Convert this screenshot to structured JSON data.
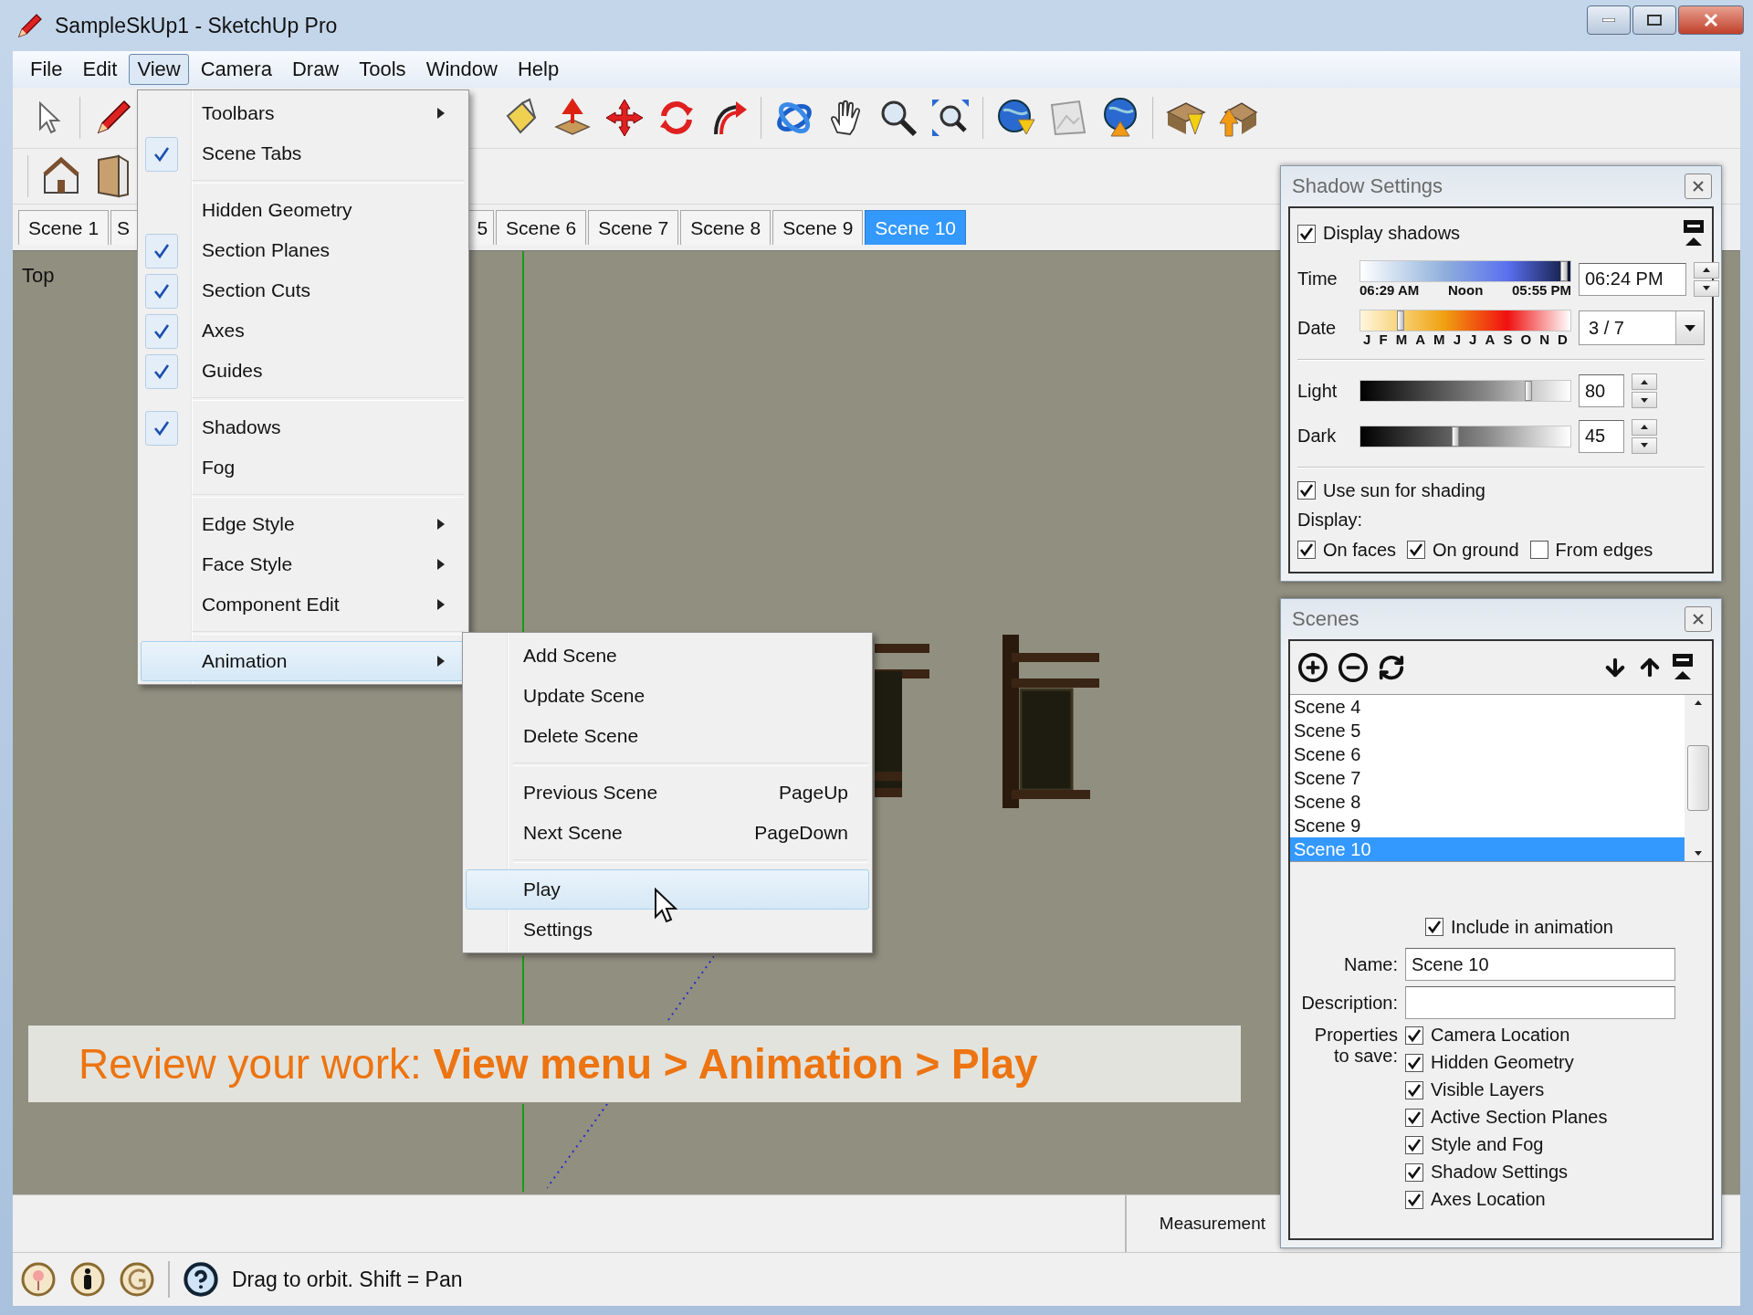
{
  "window": {
    "title": "SampleSkUp1 - SketchUp Pro"
  },
  "menu_bar": [
    {
      "label": "File",
      "selected": false
    },
    {
      "label": "Edit",
      "selected": false
    },
    {
      "label": "View",
      "selected": true
    },
    {
      "label": "Camera",
      "selected": false
    },
    {
      "label": "Draw",
      "selected": false
    },
    {
      "label": "Tools",
      "selected": false
    },
    {
      "label": "Window",
      "selected": false
    },
    {
      "label": "Help",
      "selected": false
    }
  ],
  "view_menu": {
    "groups": [
      {
        "items": [
          {
            "label": "Toolbars",
            "kind": "submenu",
            "checked": false,
            "highlighted": false
          },
          {
            "label": "Scene Tabs",
            "kind": "item",
            "checked": true,
            "highlighted": false
          }
        ]
      },
      {
        "items": [
          {
            "label": "Hidden Geometry",
            "kind": "item",
            "checked": false,
            "highlighted": false
          },
          {
            "label": "Section Planes",
            "kind": "item",
            "checked": true,
            "highlighted": false
          },
          {
            "label": "Section Cuts",
            "kind": "item",
            "checked": true,
            "highlighted": false
          },
          {
            "label": "Axes",
            "kind": "item",
            "checked": true,
            "highlighted": false
          },
          {
            "label": "Guides",
            "kind": "item",
            "checked": true,
            "highlighted": false
          }
        ]
      },
      {
        "items": [
          {
            "label": "Shadows",
            "kind": "item",
            "checked": true,
            "highlighted": false
          },
          {
            "label": "Fog",
            "kind": "item",
            "checked": false,
            "highlighted": false
          }
        ]
      },
      {
        "items": [
          {
            "label": "Edge Style",
            "kind": "submenu",
            "checked": false,
            "highlighted": false
          },
          {
            "label": "Face Style",
            "kind": "submenu",
            "checked": false,
            "highlighted": false
          },
          {
            "label": "Component Edit",
            "kind": "submenu",
            "checked": false,
            "highlighted": false
          }
        ]
      },
      {
        "items": [
          {
            "label": "Animation",
            "kind": "submenu",
            "checked": false,
            "highlighted": true
          }
        ]
      }
    ]
  },
  "animation_submenu": {
    "groups": [
      {
        "items": [
          {
            "label": "Add Scene",
            "highlighted": false
          },
          {
            "label": "Update Scene",
            "highlighted": false
          },
          {
            "label": "Delete Scene",
            "highlighted": false
          }
        ]
      },
      {
        "items": [
          {
            "label": "Previous Scene",
            "shortcut": "PageUp",
            "highlighted": false
          },
          {
            "label": "Next Scene",
            "shortcut": "PageDown",
            "highlighted": false
          }
        ]
      },
      {
        "items": [
          {
            "label": "Play",
            "highlighted": true
          },
          {
            "label": "Settings",
            "highlighted": false
          }
        ]
      }
    ]
  },
  "scene_tabs": [
    {
      "label": "Scene 1",
      "selected": false
    },
    {
      "label": "S",
      "selected": false
    },
    {
      "label": "5",
      "selected": false
    },
    {
      "label": "Scene 6",
      "selected": false
    },
    {
      "label": "Scene 7",
      "selected": false
    },
    {
      "label": "Scene 8",
      "selected": false
    },
    {
      "label": "Scene 9",
      "selected": false
    },
    {
      "label": "Scene 10",
      "selected": true
    }
  ],
  "viewport": {
    "view_label": "Top"
  },
  "caption": "Review your work: **View menu > Animation > Play**",
  "status_bar": {
    "measurement_label": "Measurement",
    "hint": "Drag to orbit.  Shift = Pan"
  },
  "shadow_settings": {
    "title": "Shadow Settings",
    "display_shadows": {
      "label": "Display shadows",
      "checked": true
    },
    "time": {
      "label": "Time",
      "level": 0.97,
      "ticks": [
        "06:29 AM",
        "Noon",
        "05:55 PM"
      ],
      "value": "06:24 PM"
    },
    "date": {
      "label": "Date",
      "level": 0.19,
      "months": [
        "J",
        "F",
        "M",
        "A",
        "M",
        "J",
        "J",
        "A",
        "S",
        "O",
        "N",
        "D"
      ],
      "value": "3 / 7"
    },
    "light": {
      "label": "Light",
      "level": 0.8,
      "value": "80"
    },
    "dark": {
      "label": "Dark",
      "level": 0.45,
      "value": "45"
    },
    "use_sun": {
      "label": "Use sun for shading",
      "checked": true
    },
    "display_label": "Display:",
    "display_options": [
      {
        "label": "On faces",
        "checked": true
      },
      {
        "label": "On ground",
        "checked": true
      },
      {
        "label": "From edges",
        "checked": false
      }
    ]
  },
  "scenes": {
    "title": "Scenes",
    "list": [
      {
        "label": "Scene 4",
        "selected": false
      },
      {
        "label": "Scene 5",
        "selected": false
      },
      {
        "label": "Scene 6",
        "selected": false
      },
      {
        "label": "Scene 7",
        "selected": false
      },
      {
        "label": "Scene 8",
        "selected": false
      },
      {
        "label": "Scene 9",
        "selected": false
      },
      {
        "label": "Scene 10",
        "selected": true
      }
    ],
    "include_in_animation": {
      "label": "Include in animation",
      "checked": true
    },
    "name_label": "Name:",
    "name_value": "Scene 10",
    "description_label": "Description:",
    "properties_label": "Properties to save:",
    "properties": [
      {
        "label": "Camera Location",
        "checked": true
      },
      {
        "label": "Hidden Geometry",
        "checked": true
      },
      {
        "label": "Visible Layers",
        "checked": true
      },
      {
        "label": "Active Section Planes",
        "checked": true
      },
      {
        "label": "Style and Fog",
        "checked": true
      },
      {
        "label": "Shadow Settings",
        "checked": true
      },
      {
        "label": "Axes Location",
        "checked": true
      }
    ]
  }
}
